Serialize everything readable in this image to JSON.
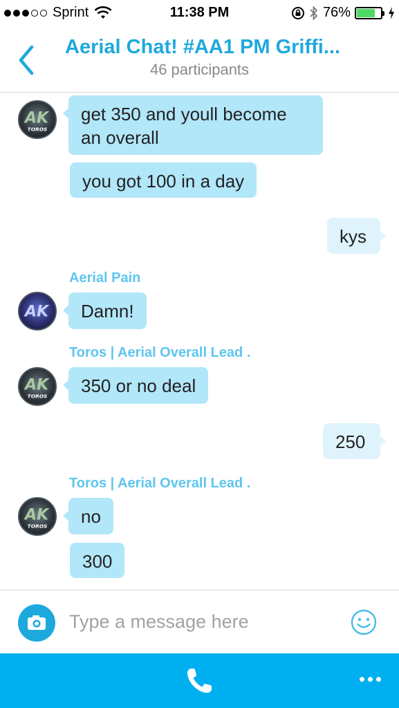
{
  "status_bar": {
    "carrier": "Sprint",
    "time": "11:38 PM",
    "battery_percent": "76%",
    "battery_level": 0.76
  },
  "header": {
    "title": "Aerial Chat! #AA1 PM Griffi...",
    "subtitle": "46 participants"
  },
  "messages": [
    {
      "text_line1": "get 350 and youll become",
      "text_line2": "an overall"
    },
    {
      "text": "you got 100 in a day"
    },
    {
      "text": "kys"
    },
    {
      "sender": "Aerial Pain",
      "text": "Damn!"
    },
    {
      "sender": "Toros | Aerial Overall Lead .",
      "text": "350 or no deal"
    },
    {
      "text": "250"
    },
    {
      "sender": "Toros | Aerial Overall Lead .",
      "text": "no"
    },
    {
      "text": "300"
    }
  ],
  "avatars": {
    "toros_label": "TOROS",
    "logo_text": "AK"
  },
  "composer": {
    "placeholder": "Type a message here"
  },
  "colors": {
    "accent": "#1ea9dc",
    "bubble_in": "#b2e6f9",
    "bubble_out": "#dff3fc",
    "bottom_bar": "#00aff0"
  },
  "icons": [
    "back-chevron-icon",
    "wifi-icon",
    "lock-rotation-icon",
    "bluetooth-icon",
    "battery-icon",
    "charging-bolt-icon",
    "camera-icon",
    "emoji-icon",
    "phone-icon",
    "more-icon"
  ]
}
